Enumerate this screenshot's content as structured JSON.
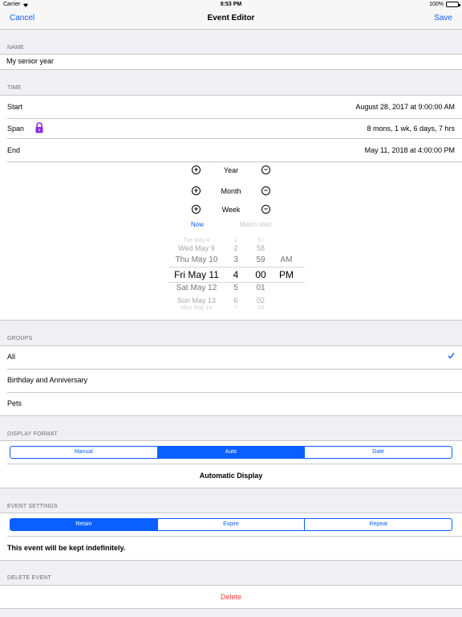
{
  "status": {
    "carrier": "Carrier",
    "time": "8:53 PM",
    "battery": "100%"
  },
  "nav": {
    "cancel": "Cancel",
    "title": "Event Editor",
    "save": "Save"
  },
  "name": {
    "header": "NAME",
    "value": "My senior year"
  },
  "time": {
    "header": "TIME",
    "start_label": "Start",
    "start_value": "August 28, 2017 at 9:00:00 AM",
    "span_label": "Span",
    "span_value": "8 mons, 1 wk, 6 days, 7 hrs",
    "end_label": "End",
    "end_value": "May 11, 2018 at 4:00:00 PM"
  },
  "steppers": {
    "year": "Year",
    "month": "Month",
    "week": "Week",
    "plus": "+",
    "minus": "−"
  },
  "picker_links": {
    "now": "Now",
    "match_start": "Match start"
  },
  "picker": {
    "days": [
      "Tue May 8",
      "Wed May 9",
      "Thu May 10",
      "Fri May 11",
      "Sat May 12",
      "Sun May 13",
      "Mon May 14"
    ],
    "hours": [
      "1",
      "2",
      "3",
      "4",
      "5",
      "6",
      "7"
    ],
    "minutes": [
      "57",
      "58",
      "59",
      "00",
      "01",
      "02",
      "03"
    ],
    "ampm": [
      "AM",
      "PM"
    ]
  },
  "groups": {
    "header": "GROUPS",
    "items": [
      "All",
      "Birthday and Anniversary",
      "Pets"
    ]
  },
  "display_format": {
    "header": "DISPLAY FORMAT",
    "options": [
      "Manual",
      "Auto",
      "Date"
    ],
    "selected": "Auto",
    "description": "Automatic Display"
  },
  "event_settings": {
    "header": "EVENT SETTINGS",
    "options": [
      "Retain",
      "Expire",
      "Repeat"
    ],
    "selected": "Retain",
    "description": "This event will be kept indefinitely."
  },
  "delete_event": {
    "header": "DELETE EVENT",
    "label": "Delete"
  },
  "colors": {
    "accent": "#0a60ff",
    "destructive": "#ff3b30",
    "lock": "#8a2be2"
  }
}
